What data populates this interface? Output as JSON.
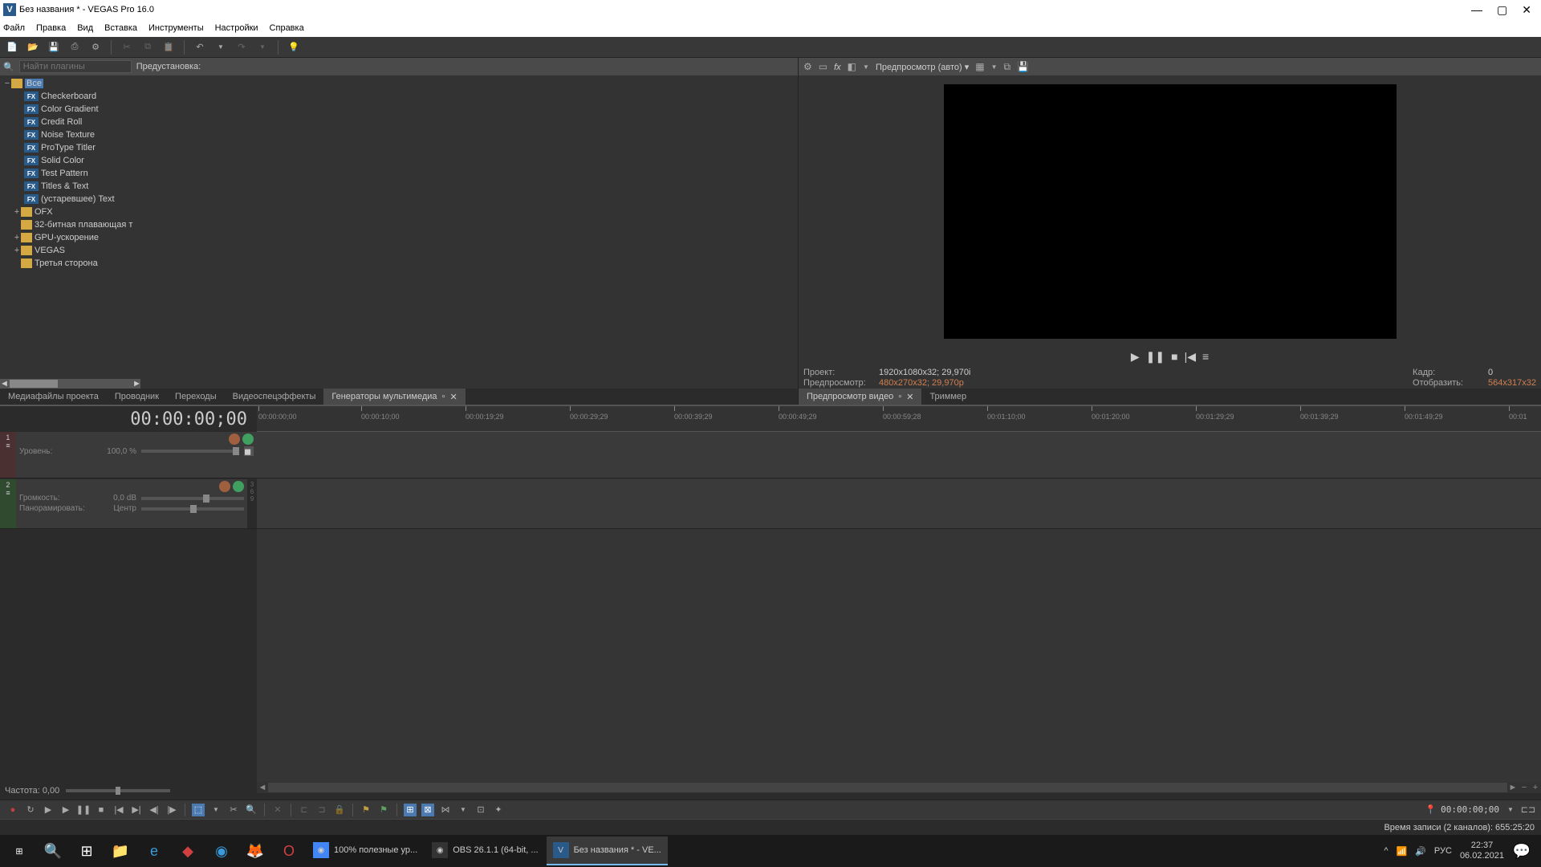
{
  "window": {
    "title": "Без названия * - VEGAS Pro 16.0",
    "icon_letter": "V"
  },
  "menu": [
    "Файл",
    "Правка",
    "Вид",
    "Вставка",
    "Инструменты",
    "Настройки",
    "Справка"
  ],
  "plugin_search_placeholder": "Найти плагины",
  "preset_label": "Предустановка:",
  "tree": {
    "root": "Все",
    "fx_items": [
      "Checkerboard",
      "Color Gradient",
      "Credit Roll",
      "Noise Texture",
      "ProType Titler",
      "Solid Color",
      "Test Pattern",
      "Titles & Text",
      "(устаревшее) Text"
    ],
    "folders": [
      "OFX",
      "32-битная плавающая т",
      "GPU-ускорение",
      "VEGAS",
      "Третья сторона"
    ]
  },
  "dock_tabs": {
    "left": [
      "Медиафайлы проекта",
      "Проводник",
      "Переходы",
      "Видеоспецэффекты",
      "Генераторы мультимедиа"
    ],
    "right": [
      "Предпросмотр видео",
      "Триммер"
    ]
  },
  "preview": {
    "mode": "Предпросмотр (авто)",
    "info": {
      "project_label": "Проект:",
      "project_value": "1920x1080x32; 29,970i",
      "preview_label": "Предпросмотр:",
      "preview_value": "480x270x32; 29,970p",
      "frame_label": "Кадр:",
      "frame_value": "0",
      "display_label": "Отобразить:",
      "display_value": "564x317x32"
    }
  },
  "timeline": {
    "timecode": "00:00:00;00",
    "ruler": [
      "00:00:00;00",
      "00:00:10;00",
      "00:00:19;29",
      "00:00:29;29",
      "00:00:39;29",
      "00:00:49;29",
      "00:00:59;28",
      "00:01:10;00",
      "00:01:20;00",
      "00:01:29;29",
      "00:01:39;29",
      "00:01:49;29",
      "00:01"
    ],
    "video_track": {
      "level_label": "Уровень:",
      "level_value": "100,0 %"
    },
    "audio_track": {
      "vol_label": "Громкость:",
      "vol_value": "0,0 dB",
      "pan_label": "Панорамировать:",
      "pan_value": "Центр"
    },
    "rate_label": "Частота: 0,00",
    "end_tc": "00:00:00;00"
  },
  "status": "Время записи (2 каналов): 655:25:20",
  "taskbar": {
    "apps": [
      {
        "label": "100% полезные ур...",
        "active": false
      },
      {
        "label": "OBS 26.1.1 (64-bit, ...",
        "active": false
      },
      {
        "label": "Без названия * - VE...",
        "active": true
      }
    ],
    "lang": "РУС",
    "time": "22:37",
    "date": "06.02.2021"
  }
}
